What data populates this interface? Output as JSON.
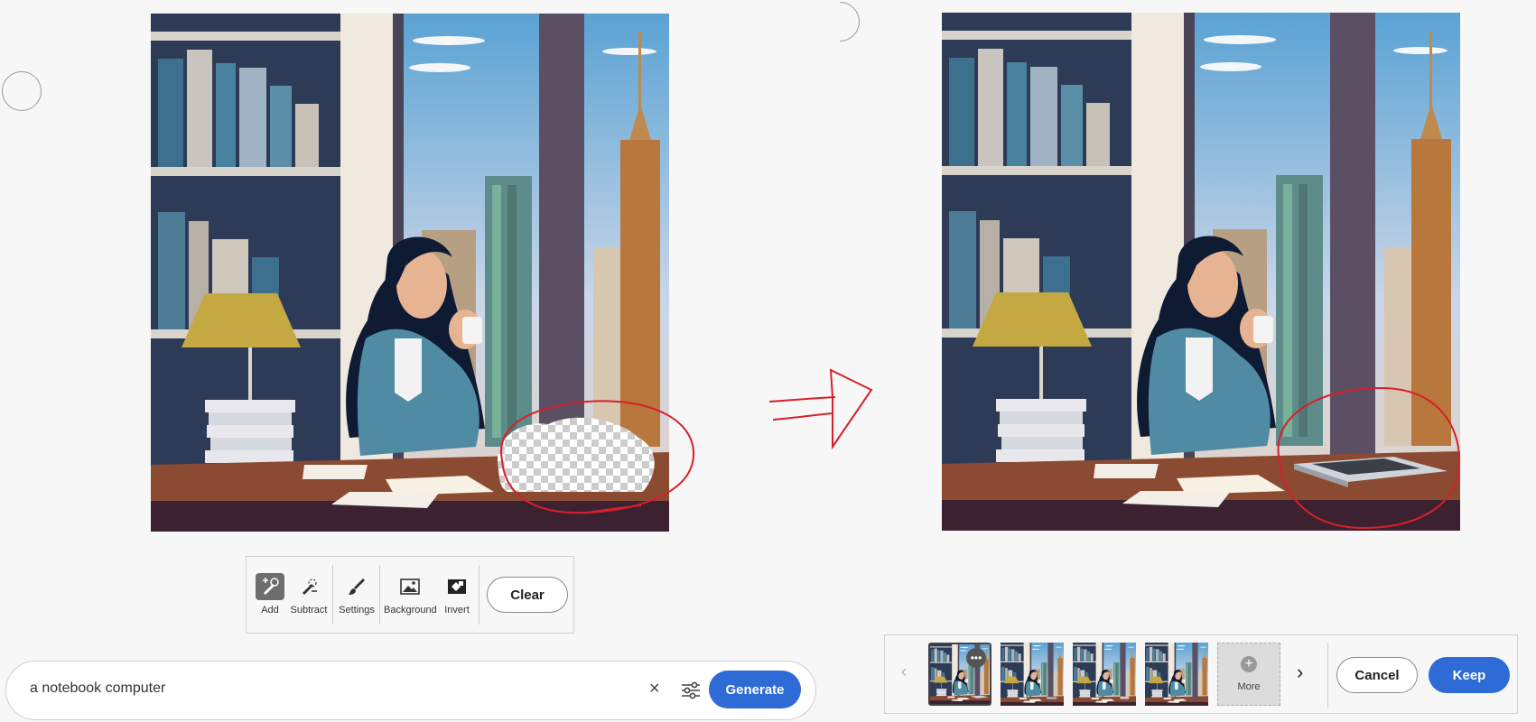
{
  "toolbar": {
    "tools": [
      {
        "label": "Add",
        "icon": "add-brush-icon"
      },
      {
        "label": "Subtract",
        "icon": "subtract-brush-icon"
      },
      {
        "label": "Settings",
        "icon": "brush-icon"
      },
      {
        "label": "Background",
        "icon": "image-icon"
      },
      {
        "label": "Invert",
        "icon": "invert-icon"
      }
    ],
    "clear_label": "Clear"
  },
  "prompt": {
    "value": "a notebook computer",
    "clear_icon": "×",
    "generate_label": "Generate"
  },
  "variations": {
    "more_label": "More",
    "cancel_label": "Cancel",
    "keep_label": "Keep"
  },
  "colors": {
    "accent": "#2e6bd6",
    "annotation": "#d8202a",
    "active_tool": "#6e6e6e"
  }
}
